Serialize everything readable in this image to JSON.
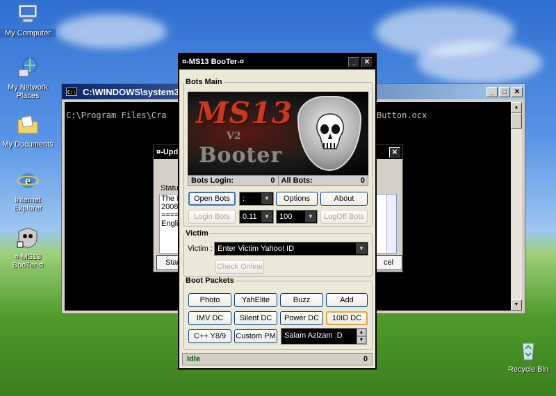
{
  "desktop": {
    "icons": [
      {
        "label": "My Computer"
      },
      {
        "label": "My Network Places"
      },
      {
        "label": "My Documents"
      },
      {
        "label": "Internet Explorer"
      },
      {
        "label": "¤-MS13 BooTer-¤"
      },
      {
        "label": "Recycle Bin"
      }
    ]
  },
  "cmd": {
    "title": "C:\\WINDOWS\\system32",
    "icon_label": "C:\\",
    "line1": "C:\\Program Files\\Cra",
    "line1_end": "Button.ocx"
  },
  "bg_dialog": {
    "title": "¤-Upd",
    "status_label": "Statu",
    "lines": [
      "The M",
      "",
      "2008,",
      "====",
      "Englis"
    ],
    "start_label": "Star",
    "cancel_label": "cel"
  },
  "app": {
    "title": "¤-MS13 BooTer-¤",
    "bots_main_legend": "Bots Main",
    "banner": {
      "line1": "MS13",
      "line2": "V2",
      "line3": "Booter"
    },
    "stats": {
      "login_label": "Bots Login:",
      "login_value": "0",
      "all_label": "All Bots:",
      "all_value": "0"
    },
    "open_bots": "Open Bots",
    "dd1": ":",
    "options": "Options",
    "about": "About",
    "login_bots": "Login Bots",
    "dd_delay": "0.11",
    "dd_count": "100",
    "logoff_bots": "LogOff Bots",
    "victim_legend": "Victim",
    "victim_label": "Victim :",
    "victim_value": "Enter Victim Yahoo! ID",
    "check_online": "Check Online",
    "packets_legend": "Boot Packets",
    "packets": [
      "Photo",
      "YahElite",
      "Buzz",
      "Add",
      "IMV DC",
      "Silent DC",
      "Power DC",
      "10ID DC",
      "C++ Y8/9",
      "Custom PM"
    ],
    "pm_text": "Salam Azizam :D",
    "status": "Idle",
    "status_count": "0"
  }
}
